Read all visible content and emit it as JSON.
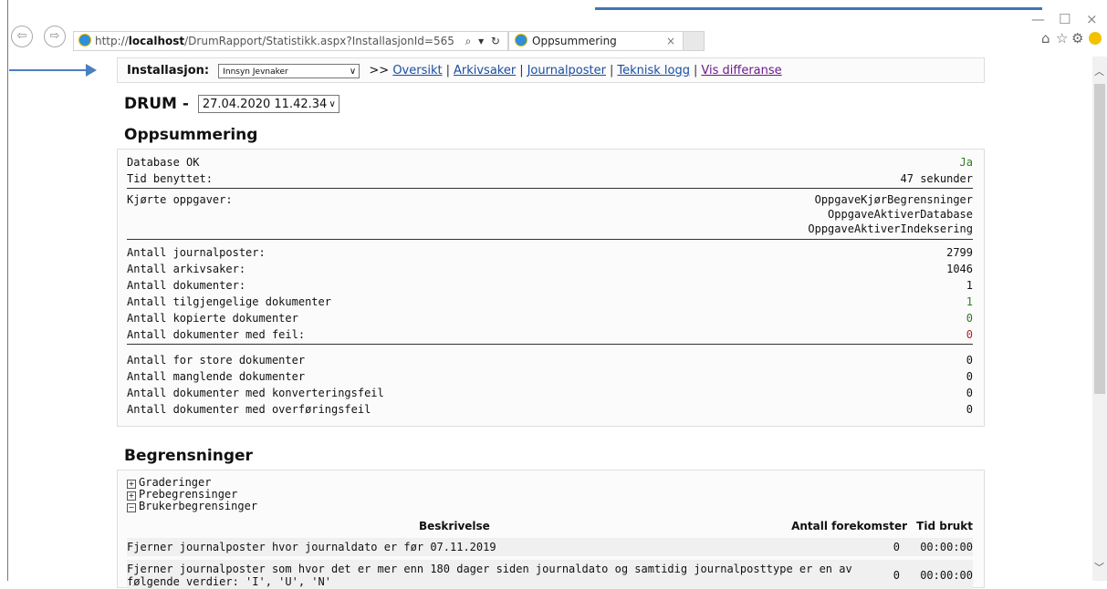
{
  "browser": {
    "url_prefix": "http://",
    "url_host": "localhost",
    "url_path": "/DrumRapport/Statistikk.aspx?InstallasjonId=565",
    "url_controls": "⌕ ▾ ↻",
    "tab_title": "Oppsummering",
    "tab_close": "×",
    "back_glyph": "⇦",
    "forward_glyph": "⇨",
    "minimize": "—",
    "maximize": "☐",
    "close": "×",
    "home_icon": "⌂",
    "star_icon": "☆",
    "gear_icon": "⚙"
  },
  "nav": {
    "label": "Installasjon:",
    "selected_installation": "Innsyn Jevnaker",
    "arrows": ">>",
    "separator": "|",
    "links": [
      "Oversikt",
      "Arkivsaker",
      "Journalposter",
      "Teknisk logg",
      "Vis differanse"
    ]
  },
  "header": {
    "title": "DRUM -",
    "selected_run": "27.04.2020 11.42.34"
  },
  "summary": {
    "heading": "Oppsummering",
    "db_label": "Database OK",
    "db_value": "Ja",
    "time_label": "Tid benyttet:",
    "time_value": "47 sekunder",
    "tasks_label": "Kjørte oppgaver:",
    "tasks": [
      "OppgaveKjørBegrensninger",
      "OppgaveAktiverDatabase",
      "OppgaveAktiverIndeksering"
    ],
    "counts": [
      {
        "label": "Antall journalposter:",
        "value": "2799"
      },
      {
        "label": "Antall arkivsaker:",
        "value": "1046"
      },
      {
        "label": "Antall dokumenter:",
        "value": "1"
      },
      {
        "label": "Antall tilgjengelige dokumenter",
        "value": "1"
      },
      {
        "label": "Antall kopierte dokumenter",
        "value": "0"
      },
      {
        "label": "Antall dokumenter med feil:",
        "value": "0"
      }
    ],
    "errors": [
      {
        "label": "Antall for store dokumenter",
        "value": "0"
      },
      {
        "label": "Antall manglende dokumenter",
        "value": "0"
      },
      {
        "label": "Antall dokumenter med konverteringsfeil",
        "value": "0"
      },
      {
        "label": "Antall dokumenter med overføringsfeil",
        "value": "0"
      }
    ]
  },
  "limits": {
    "heading": "Begrensninger",
    "tree": [
      "Graderinger",
      "Prebegrensinger",
      "Brukerbegrensinger"
    ],
    "col_desc": "Beskrivelse",
    "col_count": "Antall forekomster",
    "col_time": "Tid brukt",
    "rows": [
      {
        "desc": "Fjerner journalposter hvor journaldato er før 07.11.2019",
        "count": "0",
        "time": "00:00:00"
      },
      {
        "desc": "Fjerner journalposter som hvor det er mer enn 180 dager siden journaldato og samtidig journalposttype er en av",
        "desc2": "følgende verdier: 'I', 'U', 'N'",
        "count": "0",
        "time": "00:00:00"
      }
    ]
  },
  "colors": {
    "link": "#1a4da1",
    "visited": "#6b1a8a",
    "ok": "#2e7d1f",
    "error": "#b3261e",
    "annotation": "#4a7fc1"
  }
}
